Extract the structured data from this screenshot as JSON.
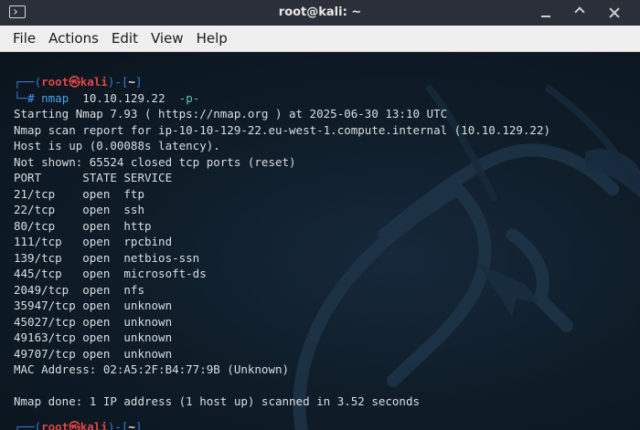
{
  "window": {
    "title": "root@kali: ~"
  },
  "menu": [
    "File",
    "Actions",
    "Edit",
    "View",
    "Help"
  ],
  "prompt": {
    "frame_top": "┌──(",
    "user": "root",
    "at": "㉿",
    "host": "kali",
    "frame_mid": ")-[",
    "dir": "~",
    "frame_end": "]",
    "frame_bottom": "└─",
    "hash": "#"
  },
  "command": {
    "name": "nmap",
    "target": "10.10.129.22",
    "flag": "-p-"
  },
  "output": [
    "Starting Nmap 7.93 ( https://nmap.org ) at 2025-06-30 13:10 UTC",
    "Nmap scan report for ip-10-10-129-22.eu-west-1.compute.internal (10.10.129.22)",
    "Host is up (0.00088s latency).",
    "Not shown: 65524 closed tcp ports (reset)",
    "PORT      STATE SERVICE",
    "21/tcp    open  ftp",
    "22/tcp    open  ssh",
    "80/tcp    open  http",
    "111/tcp   open  rpcbind",
    "139/tcp   open  netbios-ssn",
    "445/tcp   open  microsoft-ds",
    "2049/tcp  open  nfs",
    "35947/tcp open  unknown",
    "45027/tcp open  unknown",
    "49163/tcp open  unknown",
    "49707/tcp open  unknown",
    "MAC Address: 02:A5:2F:B4:77:9B (Unknown)",
    "",
    "Nmap done: 1 IP address (1 host up) scanned in 3.52 seconds"
  ],
  "colors": {
    "prompt_frame": "#3a7bd5",
    "prompt_user": "#e04646",
    "command": "#4aa3e8",
    "flag": "#5cc9a8",
    "text": "#d9dee3",
    "background": "#0d1a24"
  },
  "icons": {
    "window": "terminal-icon",
    "minimize": "minimize-icon",
    "maximize": "maximize-icon",
    "close": "close-icon",
    "background": "kali-dragon-icon"
  }
}
